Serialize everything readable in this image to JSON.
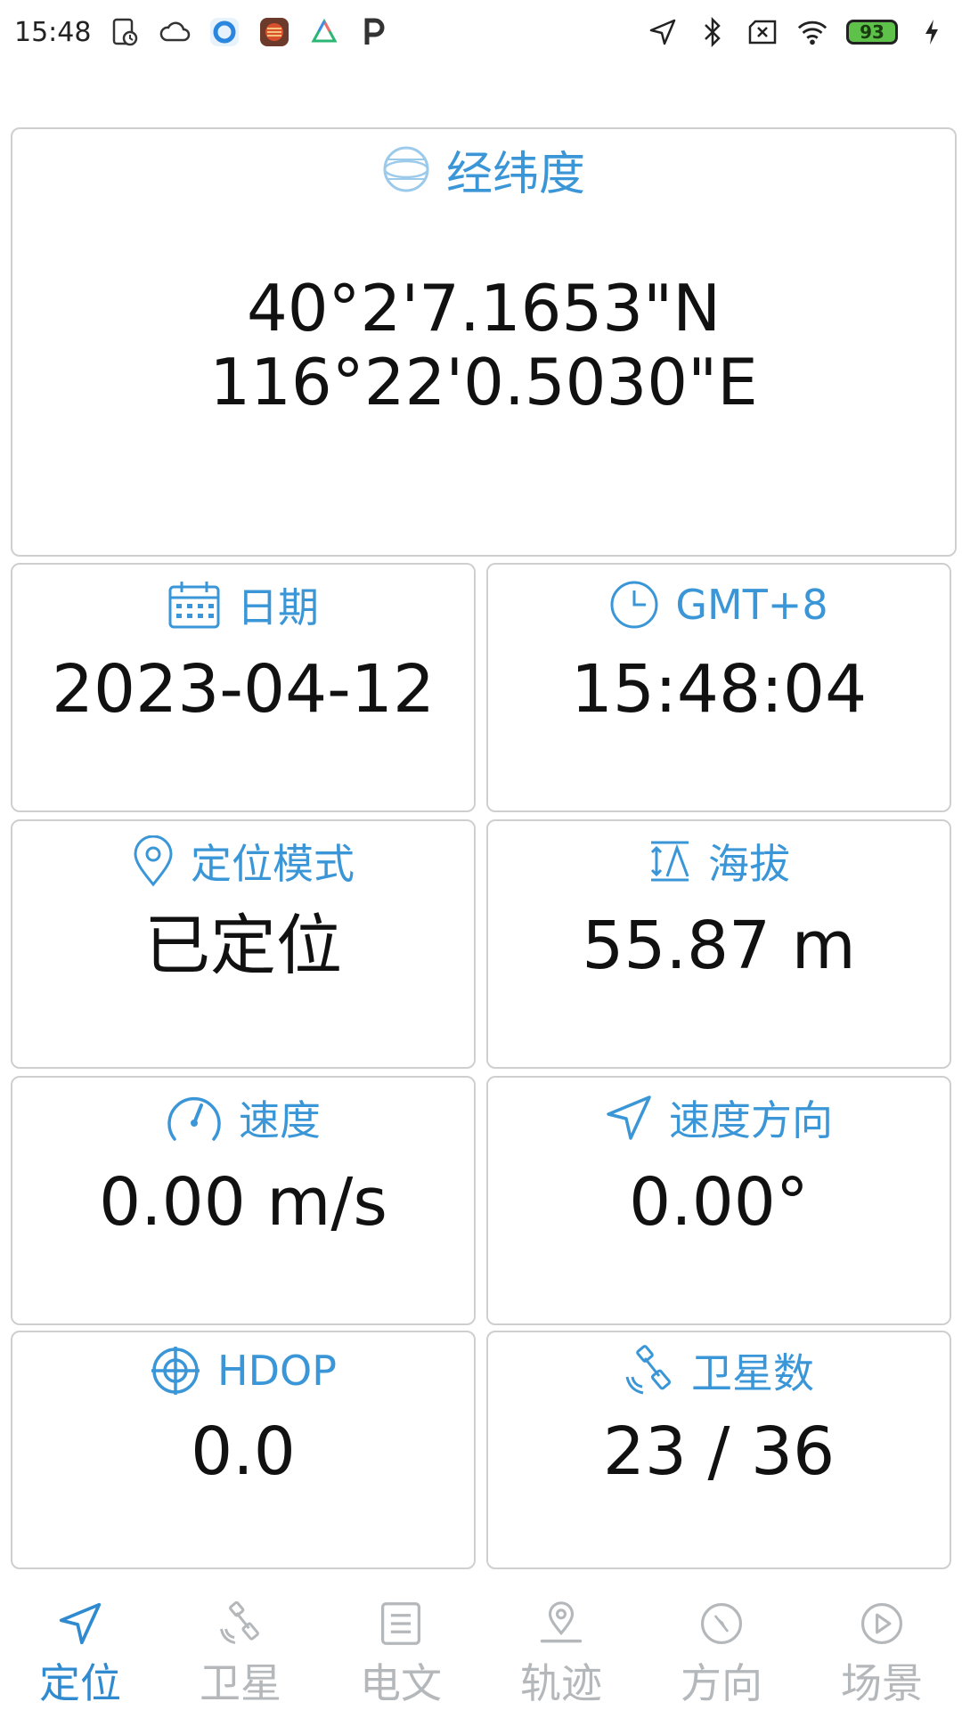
{
  "status_bar": {
    "time": "15:48",
    "battery": "93"
  },
  "cards": {
    "latlon": {
      "title": "经纬度",
      "lat": "40°2'7.1653\"N",
      "lon": "116°22'0.5030\"E"
    },
    "date": {
      "title": "日期",
      "value": "2023-04-12"
    },
    "time": {
      "title": "GMT+8",
      "value": "15:48:04"
    },
    "mode": {
      "title": "定位模式",
      "value": "已定位"
    },
    "altitude": {
      "title": "海拔",
      "value": "55.87 m"
    },
    "speed": {
      "title": "速度",
      "value": "0.00 m/s"
    },
    "bearing": {
      "title": "速度方向",
      "value": "0.00°"
    },
    "hdop": {
      "title": "HDOP",
      "value": "0.0"
    },
    "satellites": {
      "title": "卫星数",
      "value": "23 / 36"
    }
  },
  "nav": {
    "items": [
      {
        "label": "定位",
        "icon": "navigation-arrow-icon",
        "active": true
      },
      {
        "label": "卫星",
        "icon": "satellite-icon",
        "active": false
      },
      {
        "label": "电文",
        "icon": "document-icon",
        "active": false
      },
      {
        "label": "轨迹",
        "icon": "location-pin-icon",
        "active": false
      },
      {
        "label": "方向",
        "icon": "compass-icon",
        "active": false
      },
      {
        "label": "场景",
        "icon": "play-icon",
        "active": false
      }
    ]
  },
  "colors": {
    "accent": "#3a96d6",
    "nav_active": "#2f8ad0",
    "nav_inactive": "#b4b8bb",
    "card_border": "#cfcfcf"
  }
}
